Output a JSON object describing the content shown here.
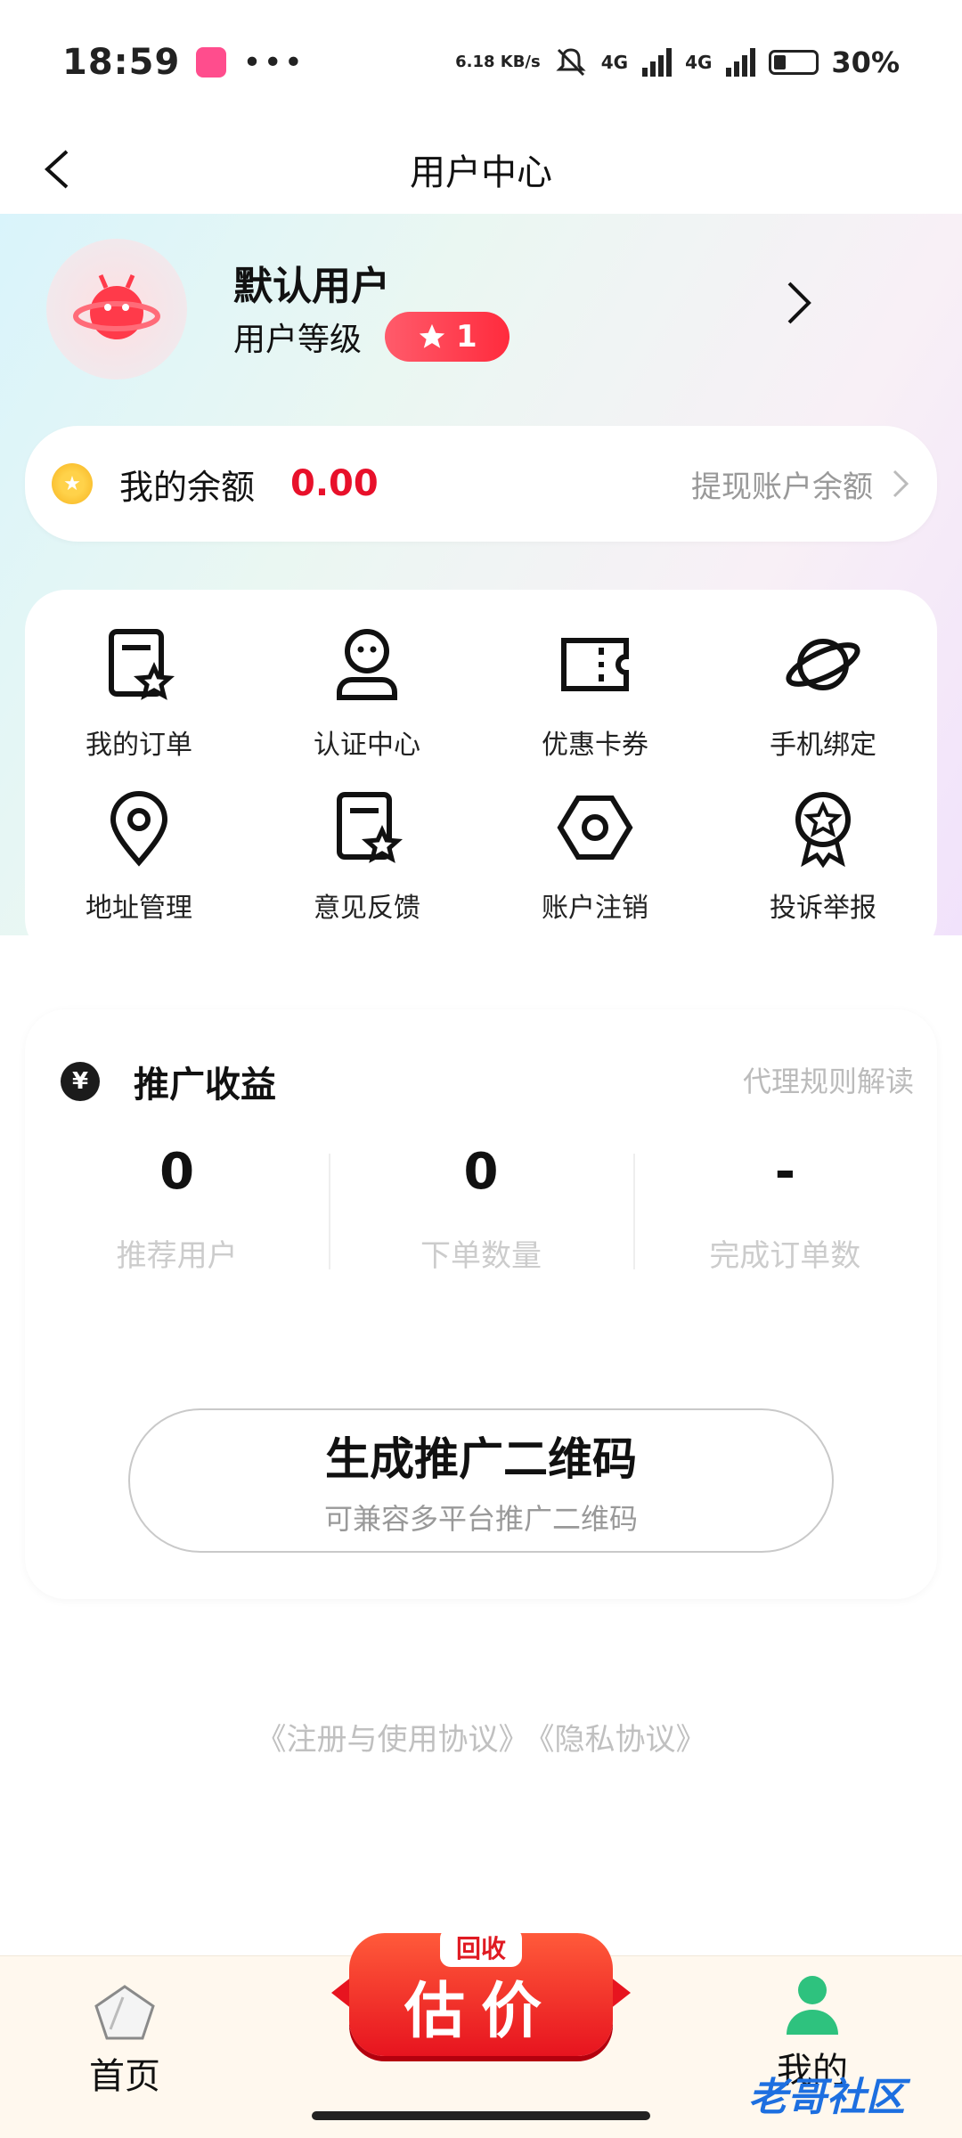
{
  "status_bar": {
    "time": "18:59",
    "network_speed": "6.18 KB/s",
    "signal_1": "4G",
    "signal_2": "4G",
    "battery": "30%",
    "battery_level": 0.3
  },
  "nav": {
    "title": "用户中心",
    "back_icon": "chevron-left-icon"
  },
  "profile": {
    "name": "默认用户",
    "level_label": "用户等级",
    "level_value": "1"
  },
  "balance": {
    "label": "我的余额",
    "amount": "0.00",
    "withdraw": "提现账户余额"
  },
  "menu": [
    {
      "label": "我的订单",
      "icon": "order-star-icon"
    },
    {
      "label": "认证中心",
      "icon": "user-icon"
    },
    {
      "label": "优惠卡券",
      "icon": "coupon-icon"
    },
    {
      "label": "手机绑定",
      "icon": "planet-icon"
    },
    {
      "label": "地址管理",
      "icon": "location-pin-icon"
    },
    {
      "label": "意见反馈",
      "icon": "feedback-star-icon"
    },
    {
      "label": "账户注销",
      "icon": "hexagon-icon"
    },
    {
      "label": "投诉举报",
      "icon": "medal-icon"
    }
  ],
  "promotion": {
    "title": "推广收益",
    "rules": "代理规则解读",
    "stats": [
      {
        "value": "0",
        "label": "推荐用户"
      },
      {
        "value": "0",
        "label": "下单数量"
      },
      {
        "value": "-",
        "label": "完成订单数"
      }
    ],
    "qr_button": {
      "title": "生成推广二维码",
      "subtitle": "可兼容多平台推广二维码"
    }
  },
  "agreements": {
    "register": "《注册与使用协议》",
    "privacy": "《隐私协议》"
  },
  "tabbar": {
    "home": "首页",
    "center_top": "回收",
    "center_main": "估价",
    "me": "我的"
  },
  "watermark": "老哥社区",
  "colors": {
    "accent_red": "#e8102a",
    "badge_red": "#ff2b3d",
    "tab_green": "#2ec27e"
  }
}
